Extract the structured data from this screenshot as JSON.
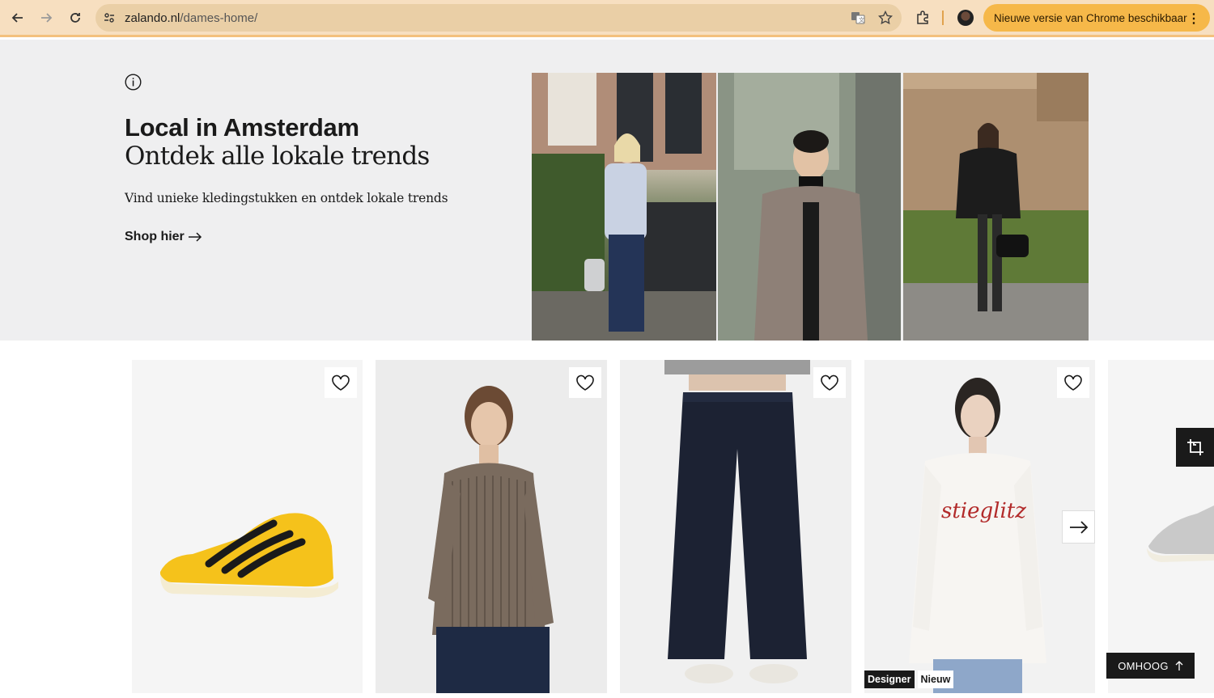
{
  "browser": {
    "url_domain": "zalando.nl",
    "url_path": "/dames-home/",
    "update_label": "Nieuwe versie van Chrome beschikbaar"
  },
  "hero": {
    "title": "Local in Amsterdam",
    "subtitle": "Ontdek alle lokale trends",
    "description": "Vind unieke kledingstukken en ontdek lokale trends",
    "link_label": "Shop hier"
  },
  "products": [
    {
      "image": "yellow-sneaker",
      "badges": []
    },
    {
      "image": "striped-shirt",
      "badges": []
    },
    {
      "image": "wide-jeans",
      "badges": []
    },
    {
      "image": "stieglitz-sweatshirt",
      "badges": [
        "Designer",
        "Nieuw"
      ],
      "print": "stieglitz"
    },
    {
      "image": "silver-sneaker",
      "badges": []
    }
  ],
  "scroll_top_label": "OMHOOG",
  "colors": {
    "chrome_bg": "#f7dfc0",
    "update_btn": "#f6b849",
    "hero_bg": "#efeff0"
  }
}
